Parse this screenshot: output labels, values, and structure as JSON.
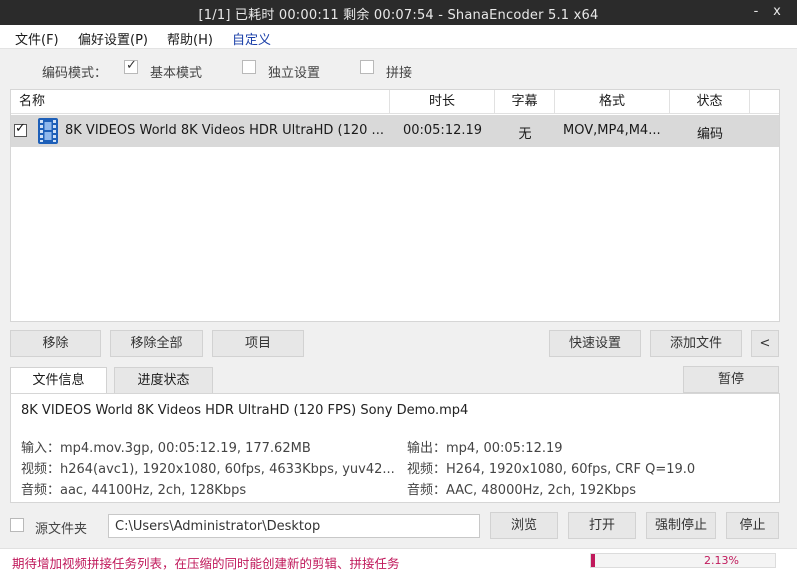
{
  "titlebar": {
    "title": "[1/1] 已耗时 00:00:11  剩余 00:07:54 - ShanaEncoder 5.1 x64",
    "minimize": "-",
    "close": "x"
  },
  "menu": {
    "file": "文件(F)",
    "prefs": "偏好设置(P)",
    "help": "帮助(H)",
    "custom": "自定义"
  },
  "mode": {
    "label": "编码模式：",
    "options": [
      "基本模式",
      "独立设置",
      "拼接"
    ],
    "checked": [
      true,
      false,
      false
    ]
  },
  "list": {
    "headers": [
      "名称",
      "时长",
      "字幕",
      "格式",
      "状态"
    ],
    "row": {
      "name": "8K VIDEOS    World 8K Videos HDR UltraHD  (120 ...",
      "duration": "00:05:12.19",
      "subtitle": "无",
      "format": "MOV,MP4,M4...",
      "status": "编码"
    }
  },
  "buttons": {
    "remove": "移除",
    "remove_all": "移除全部",
    "item": "项目",
    "quick_settings": "快速设置",
    "add_file": "添加文件",
    "collapse": "<",
    "pause": "暂停",
    "browse": "浏览",
    "open": "打开",
    "force_stop": "强制停止",
    "stop": "停止"
  },
  "tabs": [
    "文件信息",
    "进度状态"
  ],
  "info": {
    "filename": "8K VIDEOS    World 8K Videos HDR UltraHD  (120 FPS)  Sony Demo.mp4",
    "input": "输入：mp4.mov.3gp, 00:05:12.19, 177.62MB",
    "input_video": "视频：h264(avc1), 1920x1080, 60fps, 4633Kbps,  yuv42...",
    "input_audio": "音频：aac, 44100Hz, 2ch, 128Kbps",
    "output": "输出：mp4, 00:05:12.19",
    "output_video": "视频：H264, 1920x1080, 60fps, CRF Q=19.0",
    "output_audio": "音频：AAC, 48000Hz, 2ch, 192Kbps"
  },
  "source": {
    "label": "源文件夹",
    "path": "C:\\Users\\Administrator\\Desktop"
  },
  "status": {
    "message": "期待增加视频拼接任务列表，在压缩的同时能创建新的剪辑、拼接任务",
    "progress_text": "2.13%",
    "progress": 0.0213
  },
  "colors": {
    "titlebar": "#2b2b2b",
    "accent": "#c0195b",
    "link": "#1a3fa8"
  }
}
